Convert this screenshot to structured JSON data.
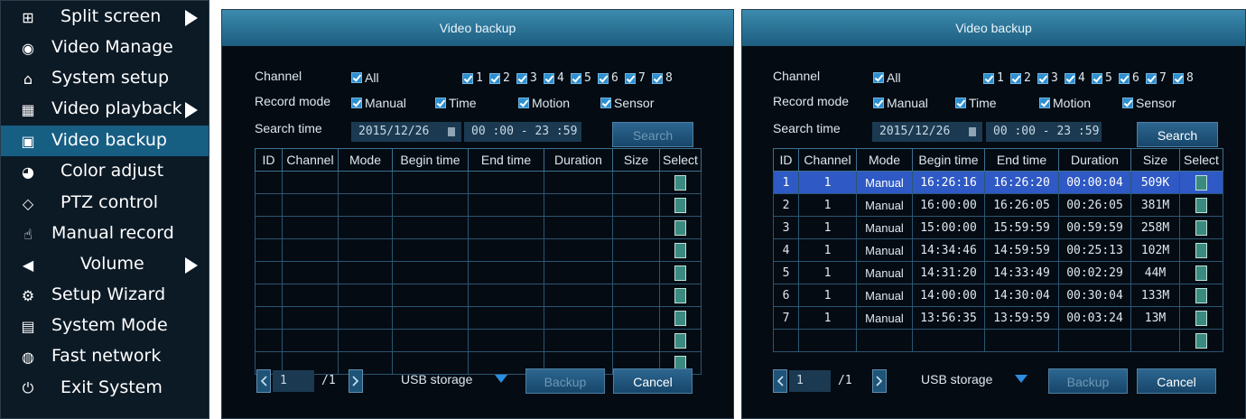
{
  "menu": {
    "items": [
      {
        "label": "Split screen",
        "icon": "grid-icon",
        "glyph": "⊞",
        "submenu": true
      },
      {
        "label": "Video Manage",
        "icon": "video-camera-icon",
        "glyph": "◉",
        "submenu": false
      },
      {
        "label": "System setup",
        "icon": "home-icon",
        "glyph": "⌂",
        "submenu": false
      },
      {
        "label": "Video playback",
        "icon": "film-icon",
        "glyph": "▦",
        "submenu": true
      },
      {
        "label": "Video backup",
        "icon": "floppy-disk-icon",
        "glyph": "▣",
        "submenu": false
      },
      {
        "label": "Color adjust",
        "icon": "color-palette-icon",
        "glyph": "◕",
        "submenu": false
      },
      {
        "label": "PTZ control",
        "icon": "diamond-icon",
        "glyph": "◇",
        "submenu": false
      },
      {
        "label": "Manual record",
        "icon": "hand-pointer-icon",
        "glyph": "☝",
        "submenu": false
      },
      {
        "label": "Volume",
        "icon": "speaker-icon",
        "glyph": "◀",
        "submenu": true
      },
      {
        "label": "Setup Wizard",
        "icon": "gears-icon",
        "glyph": "⚙",
        "submenu": false
      },
      {
        "label": "System Mode",
        "icon": "document-gear-icon",
        "glyph": "▤",
        "submenu": false
      },
      {
        "label": "Fast network",
        "icon": "globe-icon",
        "glyph": "◍",
        "submenu": false
      },
      {
        "label": "Exit System",
        "icon": "power-icon",
        "glyph": "⏻",
        "submenu": false
      }
    ],
    "active_index": 4
  },
  "dialog_empty": {
    "title": "Video backup",
    "channel_label": "Channel",
    "record_mode_label": "Record mode",
    "search_time_label": "Search time",
    "all_label": "All",
    "channels": [
      "1",
      "2",
      "3",
      "4",
      "5",
      "6",
      "7",
      "8"
    ],
    "modes": [
      "Manual",
      "Time",
      "Motion",
      "Sensor"
    ],
    "date": "2015/12/26",
    "time_range": "00 :00 - 23 :59",
    "search_button": "Search",
    "columns": [
      "ID",
      "Channel",
      "Mode",
      "Begin time",
      "End time",
      "Duration",
      "Size",
      "Select"
    ],
    "page_current": "1",
    "page_total": "/1",
    "storage": "USB storage",
    "backup_button": "Backup",
    "cancel_button": "Cancel"
  },
  "dialog_results": {
    "title": "Video backup",
    "channel_label": "Channel",
    "record_mode_label": "Record mode",
    "search_time_label": "Search time",
    "all_label": "All",
    "channels": [
      "1",
      "2",
      "3",
      "4",
      "5",
      "6",
      "7",
      "8"
    ],
    "modes": [
      "Manual",
      "Time",
      "Motion",
      "Sensor"
    ],
    "date": "2015/12/26",
    "time_range": "00 :00 - 23 :59",
    "search_button": "Search",
    "columns": [
      "ID",
      "Channel",
      "Mode",
      "Begin time",
      "End time",
      "Duration",
      "Size",
      "Select"
    ],
    "rows": [
      {
        "id": "1",
        "channel": "1",
        "mode": "Manual",
        "begin": "16:26:16",
        "end": "16:26:20",
        "duration": "00:00:04",
        "size": "509K"
      },
      {
        "id": "2",
        "channel": "1",
        "mode": "Manual",
        "begin": "16:00:00",
        "end": "16:26:05",
        "duration": "00:26:05",
        "size": "381M"
      },
      {
        "id": "3",
        "channel": "1",
        "mode": "Manual",
        "begin": "15:00:00",
        "end": "15:59:59",
        "duration": "00:59:59",
        "size": "258M"
      },
      {
        "id": "4",
        "channel": "1",
        "mode": "Manual",
        "begin": "14:34:46",
        "end": "14:59:59",
        "duration": "00:25:13",
        "size": "102M"
      },
      {
        "id": "5",
        "channel": "1",
        "mode": "Manual",
        "begin": "14:31:20",
        "end": "14:33:49",
        "duration": "00:02:29",
        "size": "44M"
      },
      {
        "id": "6",
        "channel": "1",
        "mode": "Manual",
        "begin": "14:00:00",
        "end": "14:30:04",
        "duration": "00:30:04",
        "size": "133M"
      },
      {
        "id": "7",
        "channel": "1",
        "mode": "Manual",
        "begin": "13:56:35",
        "end": "13:59:59",
        "duration": "00:03:24",
        "size": "13M"
      }
    ],
    "selected_row_index": 0,
    "page_current": "1",
    "page_total": "/1",
    "storage": "USB storage",
    "backup_button": "Backup",
    "cancel_button": "Cancel"
  },
  "colors": {
    "menu_background": "#0c1a26",
    "menu_active": "#175e83",
    "dialog_background": "#050b12",
    "titlebar": "#2a78a0",
    "selected_row": "#2f59c5",
    "checkbox": "#2d8fd0"
  }
}
